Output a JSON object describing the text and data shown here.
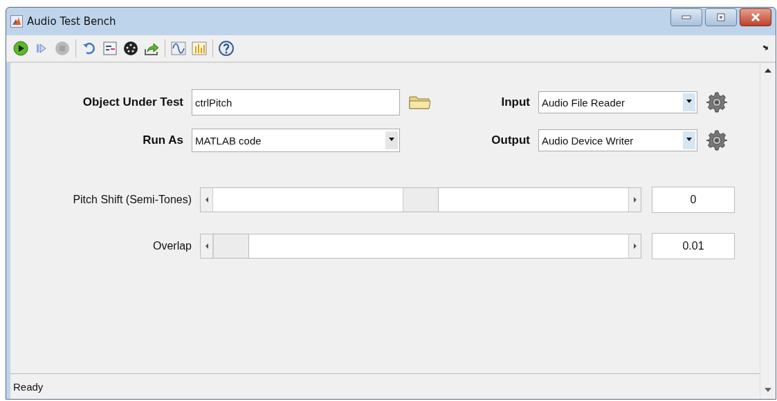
{
  "window": {
    "title": "Audio Test Bench"
  },
  "toolbar": [
    {
      "disabled": false
    },
    {
      "disabled": false
    },
    {
      "disabled": true
    },
    {
      "disabled": false
    },
    {
      "disabled": false
    },
    {
      "disabled": false
    },
    {
      "disabled": false
    },
    {
      "disabled": false
    },
    {
      "disabled": false
    },
    {
      "disabled": false
    }
  ],
  "object_under_test": {
    "label": "Object Under Test",
    "value": "ctrlPitch"
  },
  "run_as": {
    "label": "Run As",
    "value": "MATLAB code"
  },
  "input": {
    "label": "Input",
    "value": "Audio File Reader"
  },
  "output": {
    "label": "Output",
    "value": "Audio Device Writer"
  },
  "sliders": [
    {
      "label": "Pitch Shift (Semi-Tones)",
      "level": 0.5,
      "value": "0"
    },
    {
      "label": "Overlap",
      "level": 0,
      "value": "0.01"
    }
  ],
  "status_bar": {
    "text": "Ready"
  }
}
